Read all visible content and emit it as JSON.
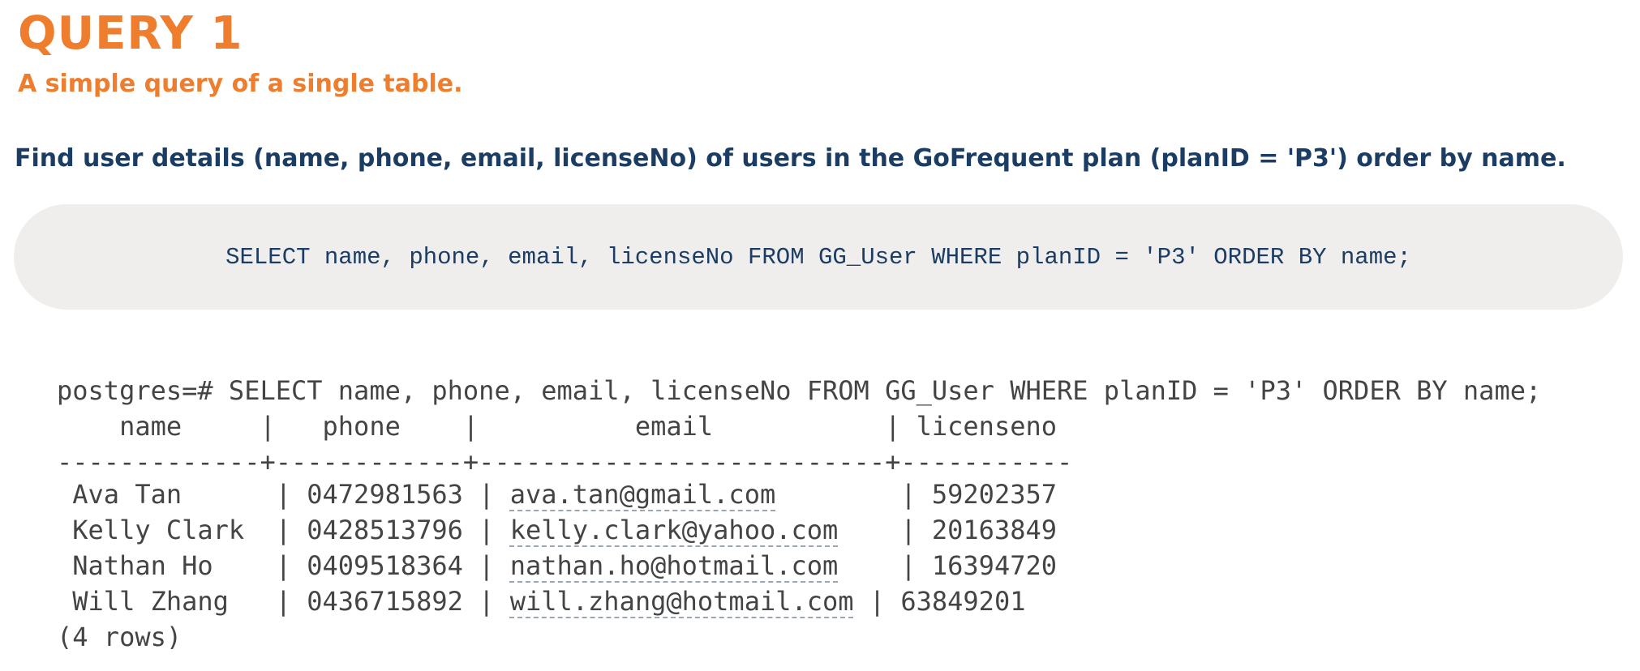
{
  "heading": {
    "title": "QUERY 1",
    "subtitle": "A simple query of a single table."
  },
  "question": "Find user details (name, phone, email, licenseNo) of users in the GoFrequent plan (planID = 'P3') order by name.",
  "sql": "SELECT name, phone, email, licenseNo FROM GG_User WHERE planID = 'P3' ORDER BY name;",
  "terminal": {
    "command_line": "postgres=# SELECT name, phone, email, licenseNo FROM GG_User WHERE planID = 'P3' ORDER BY name;",
    "header_line": "    name     |   phone    |          email           | licenseno",
    "separator_line": "-------------+------------+--------------------------+-----------",
    "rows": [
      {
        "name": "Ava Tan",
        "phone": "0472981563",
        "email": "ava.tan@gmail.com",
        "license": "59202357"
      },
      {
        "name": "Kelly Clark",
        "phone": "0428513796",
        "email": "kelly.clark@yahoo.com",
        "license": "20163849"
      },
      {
        "name": "Nathan Ho",
        "phone": "0409518364",
        "email": "nathan.ho@hotmail.com",
        "license": "16394720"
      },
      {
        "name": "Will Zhang",
        "phone": "0436715892",
        "email": "will.zhang@hotmail.com",
        "license": "63849201"
      }
    ],
    "footer": "(4 rows)"
  },
  "colors": {
    "accent_orange": "#ee7d2d",
    "navy": "#1c3d63",
    "sql_box_bg": "#efeeed",
    "terminal_text": "#444444"
  }
}
